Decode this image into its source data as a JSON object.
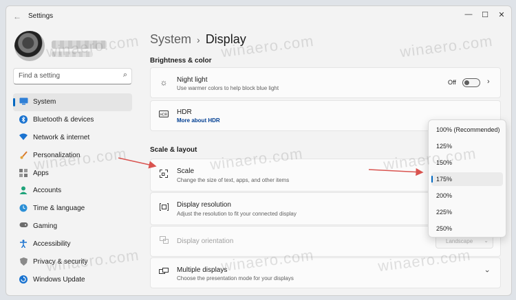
{
  "window": {
    "app_title": "Settings",
    "controls": {
      "minimize": "—",
      "maximize": "☐",
      "close": "✕"
    }
  },
  "search": {
    "placeholder": "Find a setting"
  },
  "sidebar": {
    "items": [
      {
        "label": "System",
        "icon": "monitor-icon",
        "selected": true
      },
      {
        "label": "Bluetooth & devices",
        "icon": "bluetooth-icon"
      },
      {
        "label": "Network & internet",
        "icon": "wifi-icon"
      },
      {
        "label": "Personalization",
        "icon": "brush-icon"
      },
      {
        "label": "Apps",
        "icon": "apps-icon"
      },
      {
        "label": "Accounts",
        "icon": "person-icon"
      },
      {
        "label": "Time & language",
        "icon": "globe-clock-icon"
      },
      {
        "label": "Gaming",
        "icon": "gamepad-icon"
      },
      {
        "label": "Accessibility",
        "icon": "accessibility-icon"
      },
      {
        "label": "Privacy & security",
        "icon": "shield-icon"
      },
      {
        "label": "Windows Update",
        "icon": "update-icon"
      }
    ]
  },
  "breadcrumb": {
    "parent": "System",
    "separator": "›",
    "current": "Display"
  },
  "sections": {
    "brightness": "Brightness & color",
    "scale_layout": "Scale & layout"
  },
  "cards": {
    "night_light": {
      "title": "Night light",
      "subtitle": "Use warmer colors to help block blue light",
      "toggle_label": "Off",
      "toggle_on": false
    },
    "hdr": {
      "title": "HDR",
      "link": "More about HDR"
    },
    "scale": {
      "title": "Scale",
      "subtitle": "Change the size of text, apps, and other items"
    },
    "resolution": {
      "title": "Display resolution",
      "subtitle": "Adjust the resolution to fit your connected display"
    },
    "orientation": {
      "title": "Display orientation",
      "value": "Landscape"
    },
    "multiple": {
      "title": "Multiple displays",
      "subtitle": "Choose the presentation mode for your displays"
    }
  },
  "scale_dropdown": {
    "options": [
      "100% (Recommended)",
      "125%",
      "150%",
      "175%",
      "200%",
      "225%",
      "250%"
    ],
    "selected": "175%"
  },
  "watermark": "winaero.com",
  "colors": {
    "accent": "#0067c0",
    "arrow": "#d9534f",
    "link": "#003e92"
  }
}
